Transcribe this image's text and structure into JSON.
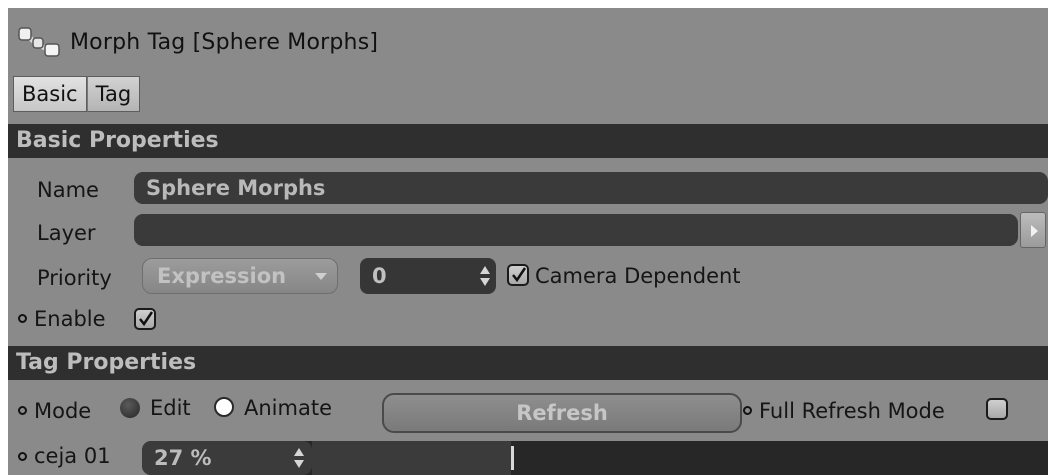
{
  "window": {
    "title": "Morph Tag [Sphere Morphs]",
    "icon": "morph-tag-icon"
  },
  "tabs": [
    {
      "label": "Basic",
      "active": true
    },
    {
      "label": "Tag",
      "active": false
    }
  ],
  "basic_properties": {
    "header": "Basic Properties",
    "name_label": "Name",
    "name_value": "Sphere Morphs",
    "layer_label": "Layer",
    "layer_value": "",
    "priority_label": "Priority",
    "priority_mode": "Expression",
    "priority_value": "0",
    "camera_dependent_label": "Camera Dependent",
    "camera_dependent_checked": true,
    "enable_label": "Enable",
    "enable_checked": true
  },
  "tag_properties": {
    "header": "Tag Properties",
    "mode_label": "Mode",
    "mode_options": [
      "Edit",
      "Animate"
    ],
    "mode_selected": "Animate",
    "refresh_label": "Refresh",
    "full_refresh_label": "Full Refresh Mode",
    "full_refresh_checked": false,
    "morph_label": "ceja 01",
    "morph_value": "27 %",
    "morph_fraction": 0.27
  },
  "colors": {
    "panel_bg": "#8a8a8a",
    "header_bg": "#2f2f2f",
    "field_bg": "#3a3a3a",
    "field_text": "#b9b9b9"
  }
}
